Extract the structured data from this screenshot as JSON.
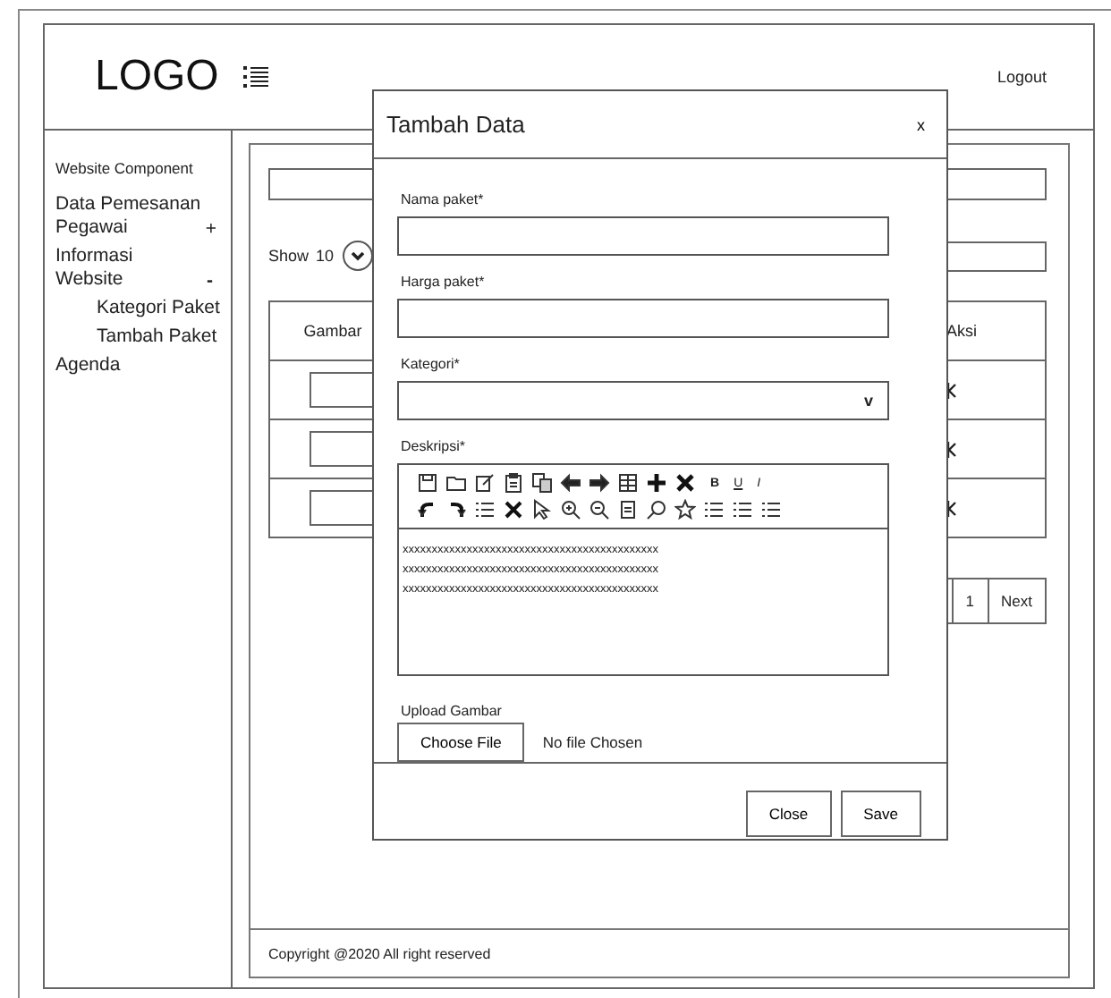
{
  "header": {
    "logo": "LOGO",
    "logout": "Logout"
  },
  "sidebar": {
    "title": "Website Component",
    "items": [
      {
        "label": "Data Pemesanan Pegawai",
        "toggle": "+",
        "expanded": false
      },
      {
        "label": "Informasi Website",
        "toggle": "-",
        "expanded": true,
        "children": [
          {
            "label": "Kategori Paket"
          },
          {
            "label": "Tambah Paket"
          }
        ]
      },
      {
        "label": "Agenda"
      }
    ]
  },
  "content": {
    "show_label": "Show",
    "show_value": "10",
    "table": {
      "columns": [
        "Gambar",
        "Aksi"
      ]
    },
    "pagination": [
      "1",
      "Next"
    ],
    "footer": "Copyright @2020 All right reserved"
  },
  "modal": {
    "title": "Tambah Data",
    "close": "x",
    "fields": [
      {
        "label": "Nama paket*",
        "kind": "text"
      },
      {
        "label": "Harga paket*",
        "kind": "text"
      },
      {
        "label": "Kategori*",
        "kind": "select",
        "caret": "v"
      }
    ],
    "editor": {
      "label": "Deskripsi*",
      "format_buttons": [
        "B",
        "U",
        "I"
      ],
      "lines": [
        "xxxxxxxxxxxxxxxxxxxxxxxxxxxxxxxxxxxxxxxxxxxx",
        "xxxxxxxxxxxxxxxxxxxxxxxxxxxxxxxxxxxxxxxxxxxx",
        "xxxxxxxxxxxxxxxxxxxxxxxxxxxxxxxxxxxxxxxxxxxx"
      ]
    },
    "upload": {
      "label": "Upload Gambar",
      "button": "Choose File",
      "status": "No file Chosen"
    },
    "buttons": [
      "Close",
      "Save"
    ]
  }
}
